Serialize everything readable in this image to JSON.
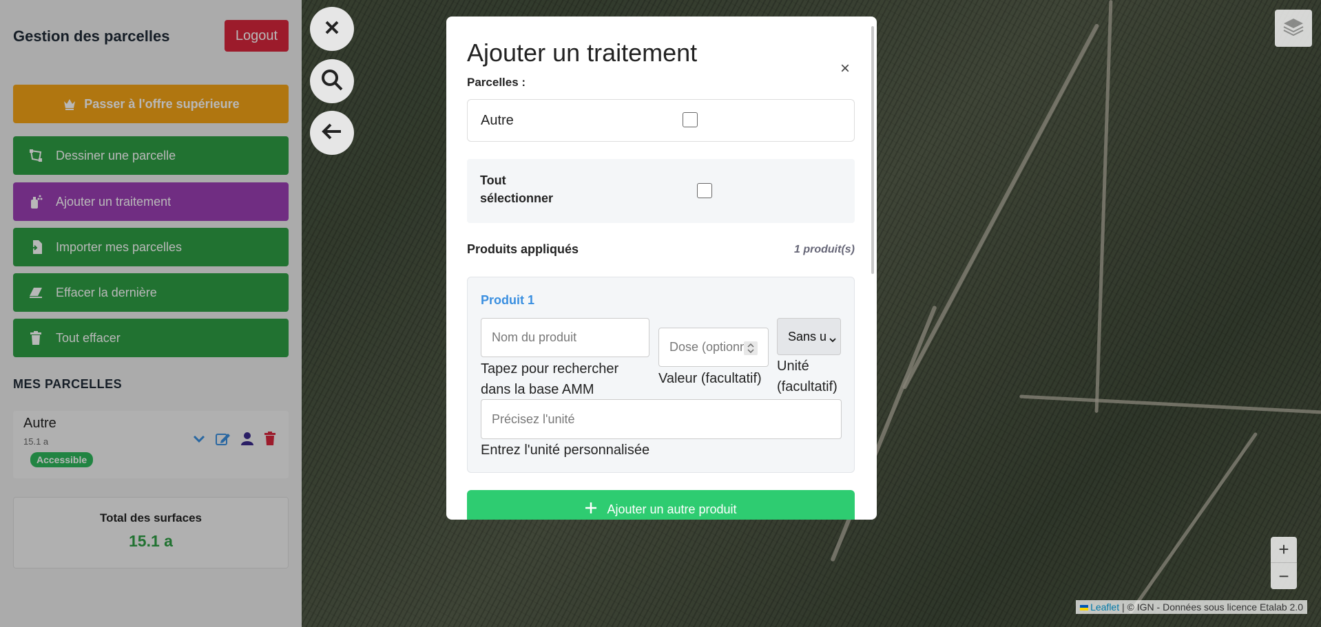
{
  "sidebar": {
    "title": "Gestion des parcelles",
    "logout_label": "Logout",
    "upgrade_label": "Passer à l'offre supérieure",
    "buttons": [
      {
        "label": "Dessiner une parcelle",
        "icon": "draw-polygon-icon",
        "color": "#2e9e44"
      },
      {
        "label": "Ajouter un traitement",
        "icon": "spray-icon",
        "color": "#9b3fb5"
      },
      {
        "label": "Importer mes parcelles",
        "icon": "file-import-icon",
        "color": "#2e9e44"
      },
      {
        "label": "Effacer la dernière",
        "icon": "eraser-icon",
        "color": "#2e9e44"
      },
      {
        "label": "Tout effacer",
        "icon": "trash-icon",
        "color": "#2e9e44"
      }
    ],
    "section_title": "MES PARCELLES",
    "parcel": {
      "name": "Autre",
      "area": "15.1 a",
      "badge": "Accessible"
    },
    "total": {
      "label": "Total des surfaces",
      "value": "15.1 a"
    }
  },
  "map": {
    "attribution_link": "Leaflet",
    "attribution_text": "| © IGN - Données sous licence Etalab 2.0",
    "zoom_in": "+",
    "zoom_out": "−"
  },
  "modal": {
    "title": "Ajouter un traitement",
    "close": "×",
    "parcelles_label": "Parcelles :",
    "parcel_option": "Autre",
    "select_all": "Tout sélectionner",
    "products_label": "Produits appliqués",
    "products_count": "1 produit(s)",
    "product": {
      "title": "Produit 1",
      "name_placeholder": "Nom du produit",
      "name_hint": "Tapez pour rechercher dans la base AMM",
      "dose_placeholder": "Dose (optionn",
      "dose_hint": "Valeur (facultatif)",
      "unit_value": "Sans u",
      "unit_hint": "Unité (facultatif)",
      "custom_unit_placeholder": "Précisez l'unité",
      "custom_unit_hint": "Entrez l'unité personnalisée"
    },
    "add_product_label": "Ajouter un autre produit"
  },
  "colors": {
    "danger": "#d9263c",
    "warning": "#f4a417",
    "success": "#2e9e44",
    "purple": "#9b3fb5",
    "accent": "#3a8fe0"
  }
}
